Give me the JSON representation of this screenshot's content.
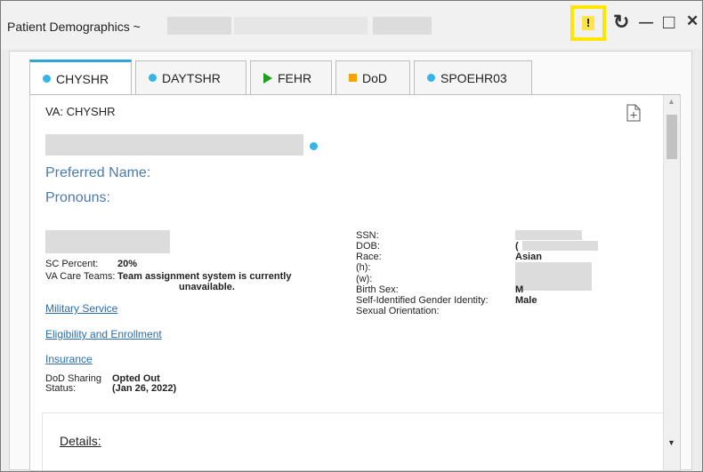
{
  "window": {
    "title": "Patient Demographics ~",
    "warning_glyph": "!",
    "refresh_glyph": "↻",
    "minimize_glyph": "—",
    "maximize_glyph": "□",
    "close_glyph": "✕"
  },
  "tabs": [
    {
      "label": "CHYSHR",
      "marker": "dot"
    },
    {
      "label": "DAYTSHR",
      "marker": "dot"
    },
    {
      "label": "FEHR",
      "marker": "triangle"
    },
    {
      "label": "DoD",
      "marker": "square"
    },
    {
      "label": "SPOEHR03",
      "marker": "dot"
    }
  ],
  "content": {
    "site": "VA: CHYSHR",
    "preferred_name_label": "Preferred Name:",
    "pronouns_label": "Pronouns:",
    "sc_percent_label": "SC Percent:",
    "sc_percent_value": "20%",
    "care_teams_label": "VA Care Teams:",
    "care_teams_value_line1": "Team assignment system is currently",
    "care_teams_value_line2": "unavailable.",
    "links": [
      "Military Service",
      "Eligibility and Enrollment",
      "Insurance"
    ],
    "dod_sharing_label_line1": "DoD Sharing",
    "dod_sharing_label_line2": "Status:",
    "dod_sharing_value_line1": "Opted Out",
    "dod_sharing_value_line2": "(Jan 26, 2022)",
    "right_fields": {
      "ssn": "SSN:",
      "dob": "DOB:",
      "race": "Race:",
      "race_value": "Asian",
      "home_phone": "(h):",
      "work_phone": "(w):",
      "birth_sex": "Birth Sex:",
      "birth_sex_value": "M",
      "gender_identity": "Self-Identified Gender Identity:",
      "gender_identity_value": "Male",
      "sexual_orientation": "Sexual Orientation:"
    },
    "details_label": "Details:",
    "dob_partial": "("
  },
  "colors": {
    "tab_active_accent": "#2da7d6",
    "dot_color": "#33b5e5",
    "fehr_triangle": "#1e9d1e",
    "dod_square": "#f5a400",
    "warning_highlight": "#ffe500",
    "link_color": "#2a6cb0"
  }
}
